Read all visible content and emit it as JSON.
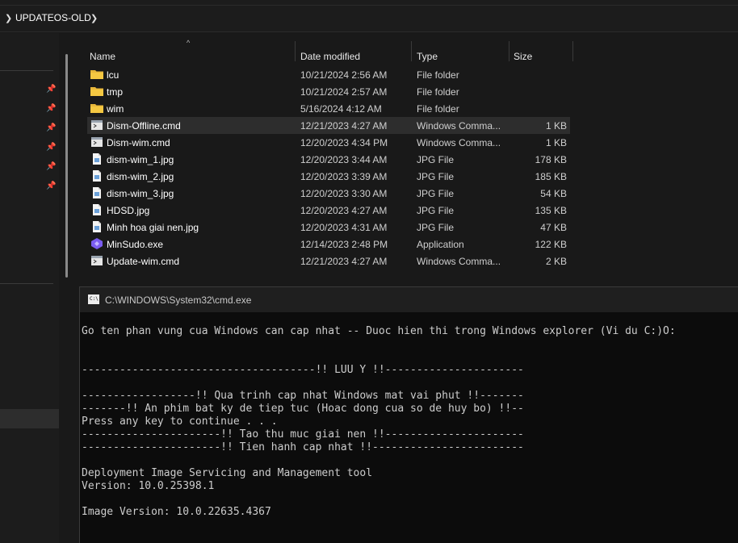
{
  "breadcrumb": {
    "current": "UPDATEOS-OLD",
    "chevron_icon": "chevron-right-icon"
  },
  "file_list": {
    "columns": {
      "name": "Name",
      "date": "Date modified",
      "type": "Type",
      "size": "Size"
    },
    "rows": [
      {
        "icon": "folder-icon",
        "name": "lcu",
        "date": "10/21/2024 2:56 AM",
        "type": "File folder",
        "size": ""
      },
      {
        "icon": "folder-icon",
        "name": "tmp",
        "date": "10/21/2024 2:57 AM",
        "type": "File folder",
        "size": ""
      },
      {
        "icon": "folder-icon",
        "name": "wim",
        "date": "5/16/2024 4:12 AM",
        "type": "File folder",
        "size": ""
      },
      {
        "icon": "cmd-file-icon",
        "name": "Dism-Offline.cmd",
        "date": "12/21/2023 4:27 AM",
        "type": "Windows Comma...",
        "size": "1 KB",
        "selected": true
      },
      {
        "icon": "cmd-file-icon",
        "name": "Dism-wim.cmd",
        "date": "12/20/2023 4:34 PM",
        "type": "Windows Comma...",
        "size": "1 KB"
      },
      {
        "icon": "jpg-file-icon",
        "name": "dism-wim_1.jpg",
        "date": "12/20/2023 3:44 AM",
        "type": "JPG File",
        "size": "178 KB"
      },
      {
        "icon": "jpg-file-icon",
        "name": "dism-wim_2.jpg",
        "date": "12/20/2023 3:39 AM",
        "type": "JPG File",
        "size": "185 KB"
      },
      {
        "icon": "jpg-file-icon",
        "name": "dism-wim_3.jpg",
        "date": "12/20/2023 3:30 AM",
        "type": "JPG File",
        "size": "54 KB"
      },
      {
        "icon": "jpg-file-icon",
        "name": "HDSD.jpg",
        "date": "12/20/2023 4:27 AM",
        "type": "JPG File",
        "size": "135 KB"
      },
      {
        "icon": "jpg-file-icon",
        "name": "Minh hoa giai nen.jpg",
        "date": "12/20/2023 4:31 AM",
        "type": "JPG File",
        "size": "47 KB"
      },
      {
        "icon": "exe-file-icon",
        "name": "MinSudo.exe",
        "date": "12/14/2023 2:48 PM",
        "type": "Application",
        "size": "122 KB"
      },
      {
        "icon": "cmd-file-icon",
        "name": "Update-wim.cmd",
        "date": "12/21/2023 4:27 AM",
        "type": "Windows Comma...",
        "size": "2 KB"
      }
    ]
  },
  "nav_pane": {
    "pin_icon": "pin-icon"
  },
  "cmd": {
    "title": "C:\\WINDOWS\\System32\\cmd.exe",
    "lines": [
      "Go ten phan vung cua Windows can cap nhat -- Duoc hien thi trong Windows explorer (Vi du C:)O:",
      "",
      "",
      "-------------------------------------!! LUU Y !!----------------------",
      "",
      "------------------!! Qua trinh cap nhat Windows mat vai phut !!-------",
      "-------!! An phim bat ky de tiep tuc (Hoac dong cua so de huy bo) !!--",
      "Press any key to continue . . .",
      "----------------------!! Tao thu muc giai nen !!----------------------",
      "----------------------!! Tien hanh cap nhat !!------------------------",
      "",
      "Deployment Image Servicing and Management tool",
      "Version: 10.0.25398.1",
      "",
      "Image Version: 10.0.22635.4367"
    ]
  },
  "colors": {
    "background": "#191919",
    "selected_row": "#2d2d2d",
    "folder": "#e8b73a",
    "console_bg": "#0c0c0c",
    "console_text": "#cccccc"
  }
}
